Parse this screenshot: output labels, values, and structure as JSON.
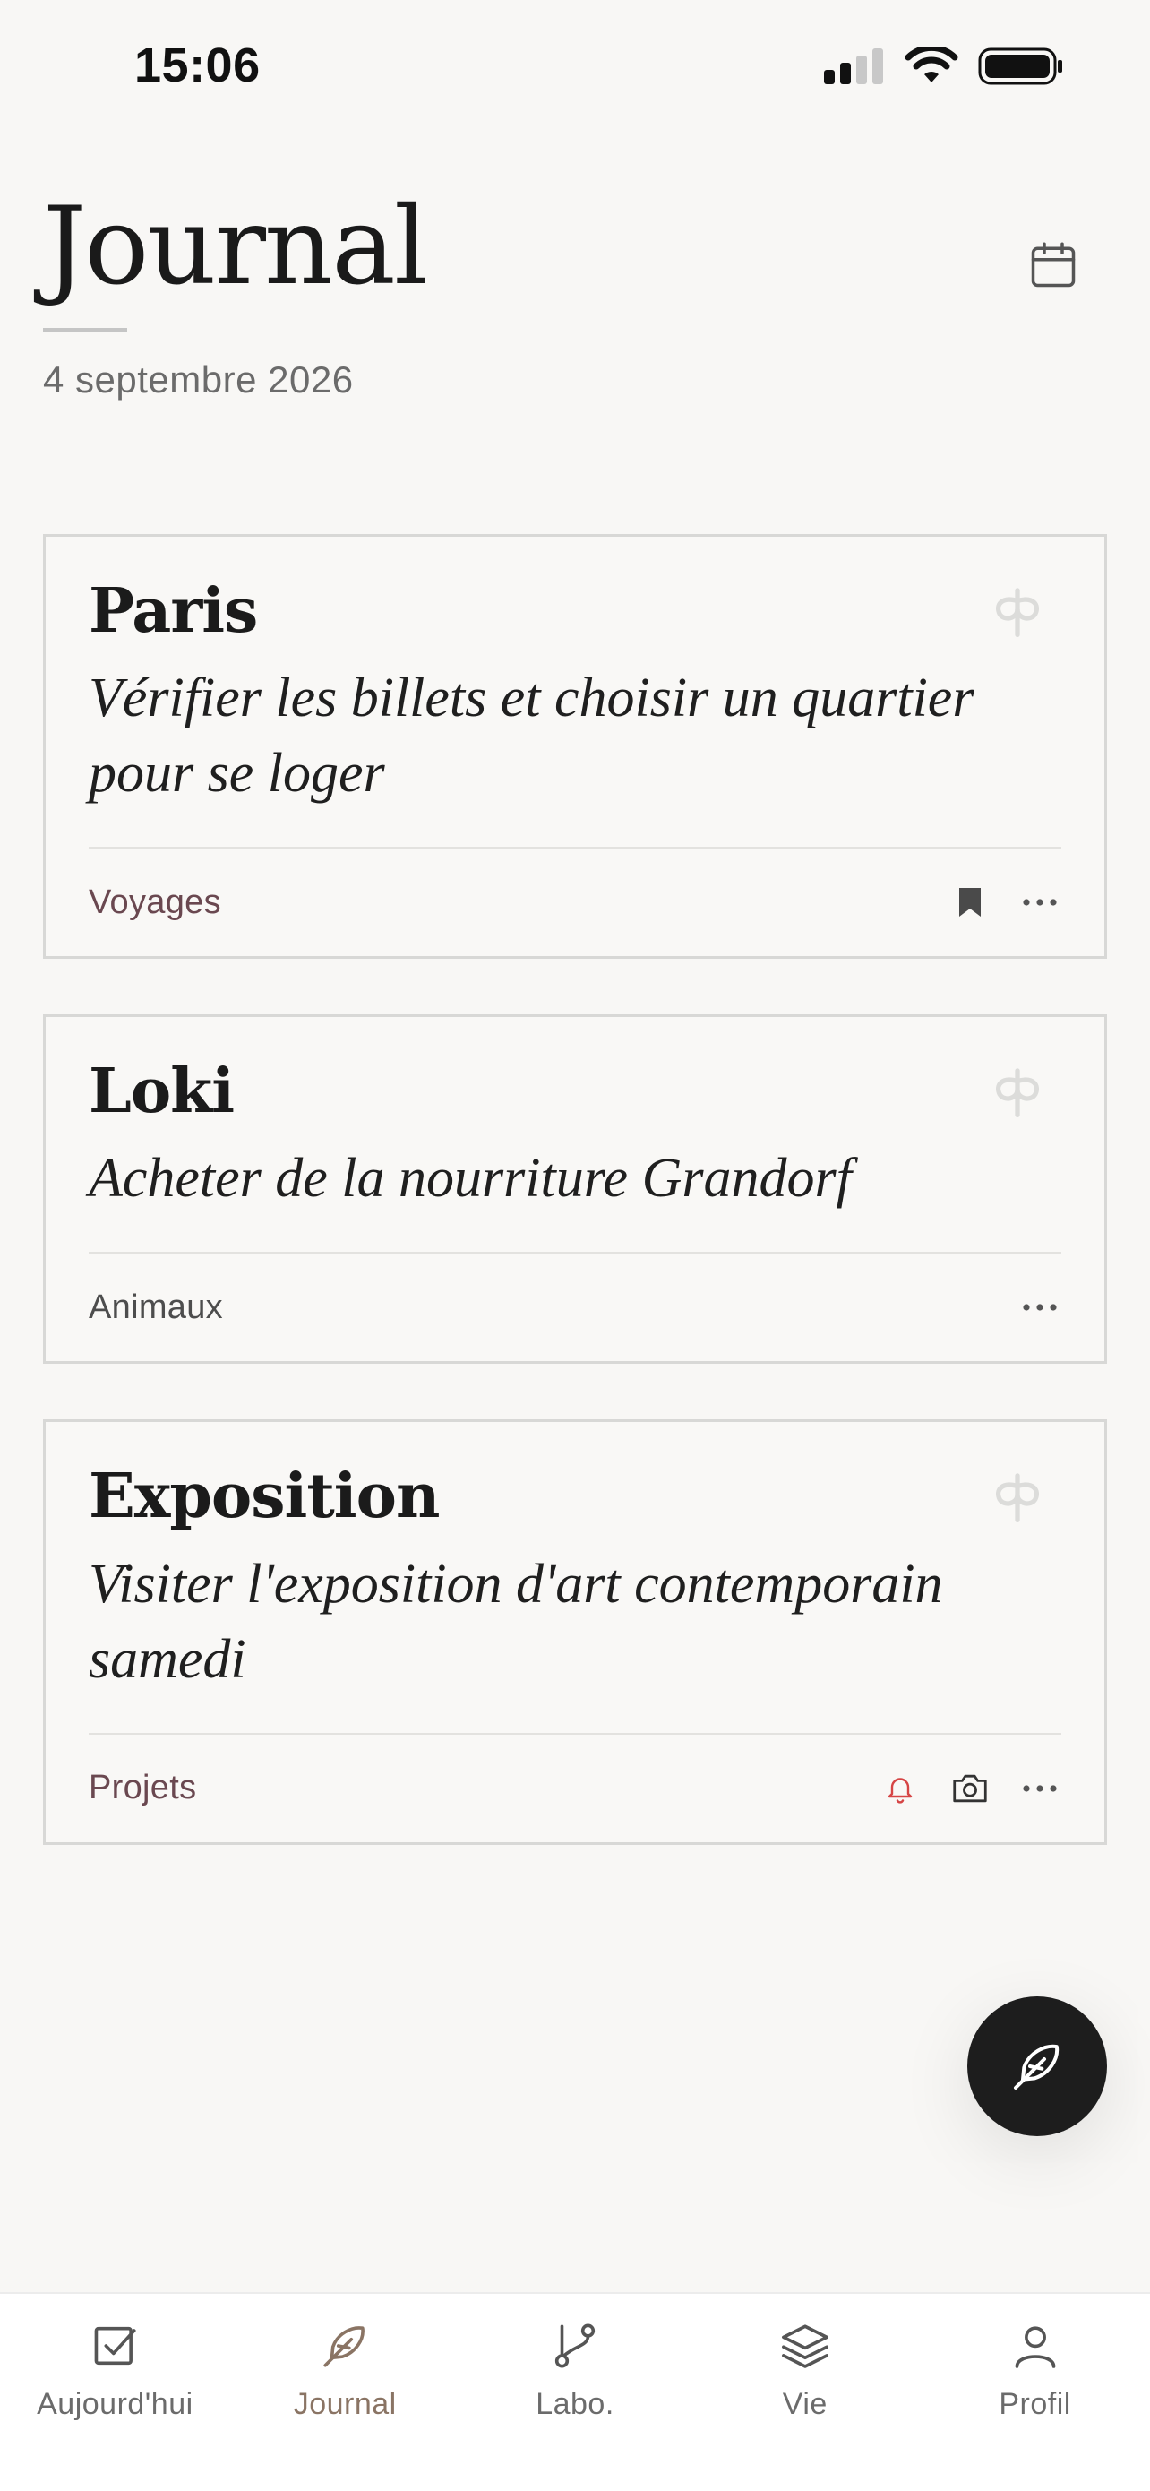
{
  "status_bar": {
    "time": "15:06"
  },
  "header": {
    "title": "Journal",
    "date": "4 septembre 2026"
  },
  "entries": [
    {
      "title": "Paris",
      "body": "Vérifier les billets et choisir un quartier pour se loger",
      "tag": "Voyages",
      "icons": [
        "bookmark-icon",
        "more-icon"
      ]
    },
    {
      "title": "Loki",
      "body": "Acheter de la nourriture Grandorf",
      "tag": "Animaux",
      "icons": [
        "more-icon"
      ]
    },
    {
      "title": "Exposition",
      "body": "Visiter l'exposition d'art contemporain samedi",
      "tag": "Projets",
      "icons": [
        "bell-icon",
        "camera-icon",
        "more-icon"
      ]
    }
  ],
  "tabs": [
    {
      "label": "Aujourd'hui",
      "icon": "checkbox-icon"
    },
    {
      "label": "Journal",
      "icon": "feather-icon",
      "active": true
    },
    {
      "label": "Labo.",
      "icon": "git-branch-icon"
    },
    {
      "label": "Vie",
      "icon": "layers-icon"
    },
    {
      "label": "Profil",
      "icon": "user-icon"
    }
  ],
  "colors": {
    "background": "#f8f7f5",
    "card_border": "#d8d8d6",
    "tag_accent": "#6a4850",
    "bell_alert": "#d64545",
    "active_tab": "#8a7464",
    "fab": "#1d1d1d"
  }
}
